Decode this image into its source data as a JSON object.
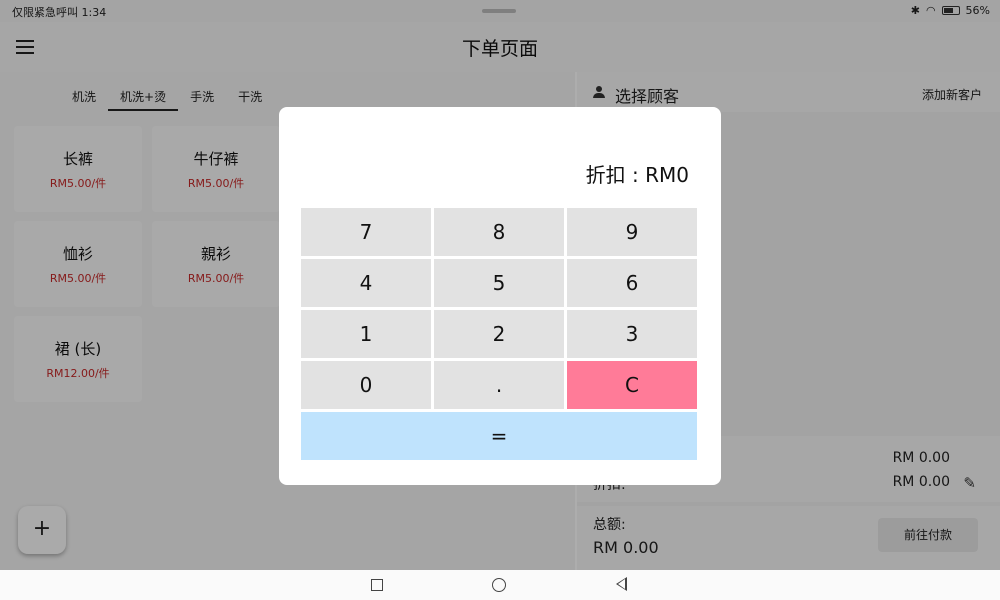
{
  "status_bar": {
    "left_text": "仅限紧急呼叫 1:34",
    "battery_percent": "56%"
  },
  "appbar": {
    "title": "下单页面"
  },
  "tabs": [
    {
      "label": "机洗",
      "active": false
    },
    {
      "label": "机洗+烫",
      "active": true
    },
    {
      "label": "手洗",
      "active": false
    },
    {
      "label": "干洗",
      "active": false
    }
  ],
  "products": [
    {
      "name": "长裤",
      "price": "RM5.00/件"
    },
    {
      "name": "牛仔裤",
      "price": "RM5.00/件"
    },
    {
      "name": "恤衫",
      "price": "RM5.00/件"
    },
    {
      "name": "親衫",
      "price": "RM5.00/件"
    },
    {
      "name": "裙 (长)",
      "price": "RM12.00/件"
    }
  ],
  "fab_label": "+",
  "customer": {
    "select_label": "选择顾客",
    "add_label": "添加新客户"
  },
  "summary": {
    "subtotal_value": "RM 0.00",
    "discount_label": "折扣:",
    "discount_value": "RM 0.00"
  },
  "total": {
    "label": "总额:",
    "value": "RM 0.00",
    "checkout_label": "前往付款"
  },
  "dialog": {
    "display": "折扣 : RM0",
    "keys": [
      {
        "label": "7"
      },
      {
        "label": "8"
      },
      {
        "label": "9"
      },
      {
        "label": "4"
      },
      {
        "label": "5"
      },
      {
        "label": "6"
      },
      {
        "label": "1"
      },
      {
        "label": "2"
      },
      {
        "label": "3"
      },
      {
        "label": "0"
      },
      {
        "label": "."
      },
      {
        "label": "C"
      }
    ],
    "equals_label": "=",
    "colors": {
      "clear_key": "#ff7b98",
      "equals_key": "#bfe3fd",
      "key": "#e2e2e2"
    }
  },
  "icons": [
    "menu-icon",
    "person-icon",
    "pencil-icon",
    "recent-apps-icon",
    "home-icon",
    "back-icon"
  ]
}
